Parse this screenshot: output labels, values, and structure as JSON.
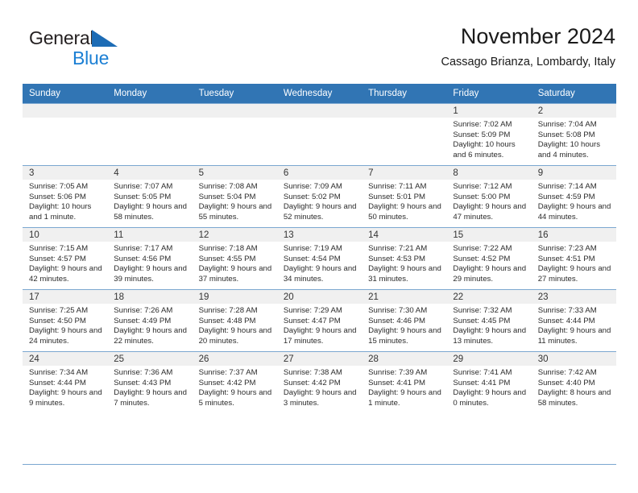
{
  "brand": {
    "word1": "General",
    "word2": "Blue",
    "triangle_color": "#1d6cb5",
    "blue_color": "#1b7fd4",
    "logo_icon": "triangle-flag-icon"
  },
  "header": {
    "title": "November 2024",
    "subtitle": "Cassago Brianza, Lombardy, Italy"
  },
  "theme": {
    "header_bg": "#3175b4",
    "daynum_bg": "#f0f0f0",
    "grid_line": "#7ba7d0"
  },
  "weekdays": [
    "Sunday",
    "Monday",
    "Tuesday",
    "Wednesday",
    "Thursday",
    "Friday",
    "Saturday"
  ],
  "weeks": [
    [
      {
        "day": "",
        "sunrise": "",
        "sunset": "",
        "daylight": "",
        "empty": true
      },
      {
        "day": "",
        "sunrise": "",
        "sunset": "",
        "daylight": "",
        "empty": true
      },
      {
        "day": "",
        "sunrise": "",
        "sunset": "",
        "daylight": "",
        "empty": true
      },
      {
        "day": "",
        "sunrise": "",
        "sunset": "",
        "daylight": "",
        "empty": true
      },
      {
        "day": "",
        "sunrise": "",
        "sunset": "",
        "daylight": "",
        "empty": true
      },
      {
        "day": "1",
        "sunrise": "Sunrise: 7:02 AM",
        "sunset": "Sunset: 5:09 PM",
        "daylight": "Daylight: 10 hours and 6 minutes."
      },
      {
        "day": "2",
        "sunrise": "Sunrise: 7:04 AM",
        "sunset": "Sunset: 5:08 PM",
        "daylight": "Daylight: 10 hours and 4 minutes."
      }
    ],
    [
      {
        "day": "3",
        "sunrise": "Sunrise: 7:05 AM",
        "sunset": "Sunset: 5:06 PM",
        "daylight": "Daylight: 10 hours and 1 minute."
      },
      {
        "day": "4",
        "sunrise": "Sunrise: 7:07 AM",
        "sunset": "Sunset: 5:05 PM",
        "daylight": "Daylight: 9 hours and 58 minutes."
      },
      {
        "day": "5",
        "sunrise": "Sunrise: 7:08 AM",
        "sunset": "Sunset: 5:04 PM",
        "daylight": "Daylight: 9 hours and 55 minutes."
      },
      {
        "day": "6",
        "sunrise": "Sunrise: 7:09 AM",
        "sunset": "Sunset: 5:02 PM",
        "daylight": "Daylight: 9 hours and 52 minutes."
      },
      {
        "day": "7",
        "sunrise": "Sunrise: 7:11 AM",
        "sunset": "Sunset: 5:01 PM",
        "daylight": "Daylight: 9 hours and 50 minutes."
      },
      {
        "day": "8",
        "sunrise": "Sunrise: 7:12 AM",
        "sunset": "Sunset: 5:00 PM",
        "daylight": "Daylight: 9 hours and 47 minutes."
      },
      {
        "day": "9",
        "sunrise": "Sunrise: 7:14 AM",
        "sunset": "Sunset: 4:59 PM",
        "daylight": "Daylight: 9 hours and 44 minutes."
      }
    ],
    [
      {
        "day": "10",
        "sunrise": "Sunrise: 7:15 AM",
        "sunset": "Sunset: 4:57 PM",
        "daylight": "Daylight: 9 hours and 42 minutes."
      },
      {
        "day": "11",
        "sunrise": "Sunrise: 7:17 AM",
        "sunset": "Sunset: 4:56 PM",
        "daylight": "Daylight: 9 hours and 39 minutes."
      },
      {
        "day": "12",
        "sunrise": "Sunrise: 7:18 AM",
        "sunset": "Sunset: 4:55 PM",
        "daylight": "Daylight: 9 hours and 37 minutes."
      },
      {
        "day": "13",
        "sunrise": "Sunrise: 7:19 AM",
        "sunset": "Sunset: 4:54 PM",
        "daylight": "Daylight: 9 hours and 34 minutes."
      },
      {
        "day": "14",
        "sunrise": "Sunrise: 7:21 AM",
        "sunset": "Sunset: 4:53 PM",
        "daylight": "Daylight: 9 hours and 31 minutes."
      },
      {
        "day": "15",
        "sunrise": "Sunrise: 7:22 AM",
        "sunset": "Sunset: 4:52 PM",
        "daylight": "Daylight: 9 hours and 29 minutes."
      },
      {
        "day": "16",
        "sunrise": "Sunrise: 7:23 AM",
        "sunset": "Sunset: 4:51 PM",
        "daylight": "Daylight: 9 hours and 27 minutes."
      }
    ],
    [
      {
        "day": "17",
        "sunrise": "Sunrise: 7:25 AM",
        "sunset": "Sunset: 4:50 PM",
        "daylight": "Daylight: 9 hours and 24 minutes."
      },
      {
        "day": "18",
        "sunrise": "Sunrise: 7:26 AM",
        "sunset": "Sunset: 4:49 PM",
        "daylight": "Daylight: 9 hours and 22 minutes."
      },
      {
        "day": "19",
        "sunrise": "Sunrise: 7:28 AM",
        "sunset": "Sunset: 4:48 PM",
        "daylight": "Daylight: 9 hours and 20 minutes."
      },
      {
        "day": "20",
        "sunrise": "Sunrise: 7:29 AM",
        "sunset": "Sunset: 4:47 PM",
        "daylight": "Daylight: 9 hours and 17 minutes."
      },
      {
        "day": "21",
        "sunrise": "Sunrise: 7:30 AM",
        "sunset": "Sunset: 4:46 PM",
        "daylight": "Daylight: 9 hours and 15 minutes."
      },
      {
        "day": "22",
        "sunrise": "Sunrise: 7:32 AM",
        "sunset": "Sunset: 4:45 PM",
        "daylight": "Daylight: 9 hours and 13 minutes."
      },
      {
        "day": "23",
        "sunrise": "Sunrise: 7:33 AM",
        "sunset": "Sunset: 4:44 PM",
        "daylight": "Daylight: 9 hours and 11 minutes."
      }
    ],
    [
      {
        "day": "24",
        "sunrise": "Sunrise: 7:34 AM",
        "sunset": "Sunset: 4:44 PM",
        "daylight": "Daylight: 9 hours and 9 minutes."
      },
      {
        "day": "25",
        "sunrise": "Sunrise: 7:36 AM",
        "sunset": "Sunset: 4:43 PM",
        "daylight": "Daylight: 9 hours and 7 minutes."
      },
      {
        "day": "26",
        "sunrise": "Sunrise: 7:37 AM",
        "sunset": "Sunset: 4:42 PM",
        "daylight": "Daylight: 9 hours and 5 minutes."
      },
      {
        "day": "27",
        "sunrise": "Sunrise: 7:38 AM",
        "sunset": "Sunset: 4:42 PM",
        "daylight": "Daylight: 9 hours and 3 minutes."
      },
      {
        "day": "28",
        "sunrise": "Sunrise: 7:39 AM",
        "sunset": "Sunset: 4:41 PM",
        "daylight": "Daylight: 9 hours and 1 minute."
      },
      {
        "day": "29",
        "sunrise": "Sunrise: 7:41 AM",
        "sunset": "Sunset: 4:41 PM",
        "daylight": "Daylight: 9 hours and 0 minutes."
      },
      {
        "day": "30",
        "sunrise": "Sunrise: 7:42 AM",
        "sunset": "Sunset: 4:40 PM",
        "daylight": "Daylight: 8 hours and 58 minutes."
      }
    ]
  ]
}
